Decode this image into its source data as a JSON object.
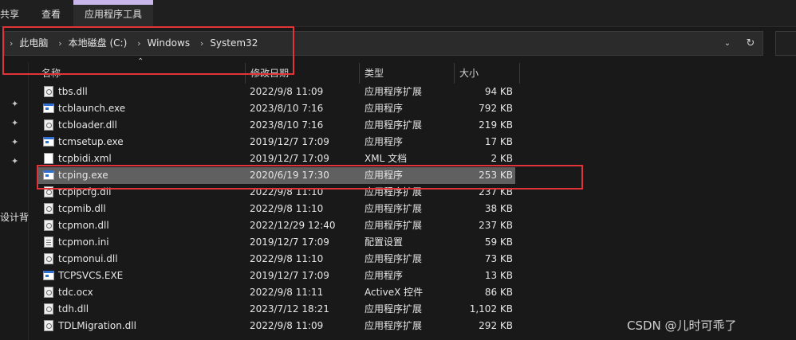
{
  "ribbon": {
    "tabs": [
      "共享",
      "查看",
      "应用程序工具"
    ]
  },
  "address": {
    "crumbs": [
      "此电脑",
      "本地磁盘 (C:)",
      "Windows",
      "System32"
    ],
    "dropdown_icon": "chevron-down-icon",
    "refresh_icon": "refresh-icon"
  },
  "sidebar": {
    "label": "设计背"
  },
  "columns": {
    "name": "名称",
    "date": "修改日期",
    "type": "类型",
    "size": "大小"
  },
  "files": [
    {
      "name": "tbs.dll",
      "date": "2022/9/8 11:09",
      "type": "应用程序扩展",
      "size": "94 KB",
      "icon": "dll"
    },
    {
      "name": "tcblaunch.exe",
      "date": "2023/8/10 7:16",
      "type": "应用程序",
      "size": "792 KB",
      "icon": "exe"
    },
    {
      "name": "tcbloader.dll",
      "date": "2023/8/10 7:16",
      "type": "应用程序扩展",
      "size": "219 KB",
      "icon": "dll"
    },
    {
      "name": "tcmsetup.exe",
      "date": "2019/12/7 17:09",
      "type": "应用程序",
      "size": "17 KB",
      "icon": "exe"
    },
    {
      "name": "tcpbidi.xml",
      "date": "2019/12/7 17:09",
      "type": "XML 文档",
      "size": "2 KB",
      "icon": "xml"
    },
    {
      "name": "tcping.exe",
      "date": "2020/6/19 17:30",
      "type": "应用程序",
      "size": "253 KB",
      "icon": "exe",
      "selected": true
    },
    {
      "name": "tcpipcfg.dll",
      "date": "2022/9/8 11:10",
      "type": "应用程序扩展",
      "size": "237 KB",
      "icon": "dll"
    },
    {
      "name": "tcpmib.dll",
      "date": "2022/9/8 11:10",
      "type": "应用程序扩展",
      "size": "38 KB",
      "icon": "dll"
    },
    {
      "name": "tcpmon.dll",
      "date": "2022/12/29 12:40",
      "type": "应用程序扩展",
      "size": "237 KB",
      "icon": "dll"
    },
    {
      "name": "tcpmon.ini",
      "date": "2019/12/7 17:09",
      "type": "配置设置",
      "size": "59 KB",
      "icon": "ini"
    },
    {
      "name": "tcpmonui.dll",
      "date": "2022/9/8 11:10",
      "type": "应用程序扩展",
      "size": "73 KB",
      "icon": "dll"
    },
    {
      "name": "TCPSVCS.EXE",
      "date": "2019/12/7 17:09",
      "type": "应用程序",
      "size": "13 KB",
      "icon": "exe"
    },
    {
      "name": "tdc.ocx",
      "date": "2022/9/8 11:11",
      "type": "ActiveX 控件",
      "size": "86 KB",
      "icon": "dll"
    },
    {
      "name": "tdh.dll",
      "date": "2023/7/12 18:21",
      "type": "应用程序扩展",
      "size": "1,102 KB",
      "icon": "dll"
    },
    {
      "name": "TDLMigration.dll",
      "date": "2022/9/8 11:09",
      "type": "应用程序扩展",
      "size": "292 KB",
      "icon": "dll"
    }
  ],
  "watermark": "CSDN @儿时可乖了",
  "colors": {
    "highlight": "#e1343a",
    "selection": "#606060",
    "accent_tab": "#c9b6ea"
  }
}
